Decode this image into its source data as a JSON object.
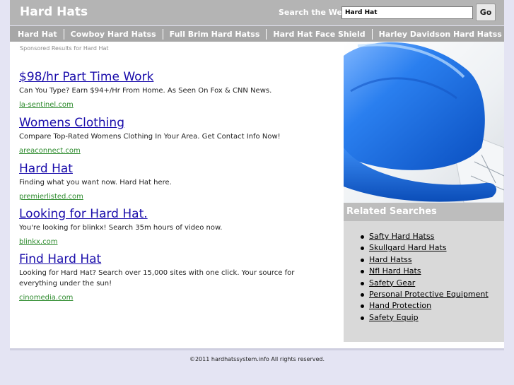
{
  "header": {
    "site_title": "Hard Hats",
    "search_label": "Search the Web:",
    "search_value": "Hard Hat",
    "search_button": "Go"
  },
  "nav": {
    "items": [
      {
        "label": "Hard Hat"
      },
      {
        "label": "Cowboy Hard Hatss"
      },
      {
        "label": "Full Brim Hard Hatss"
      },
      {
        "label": "Hard Hat Face Shield"
      },
      {
        "label": "Harley Davidson Hard Hatss"
      }
    ]
  },
  "main": {
    "sponsored_label": "Sponsored Results for Hard Hat",
    "ads": [
      {
        "title": "$98/hr Part Time Work",
        "description": "Can You Type? Earn $94+/Hr From Home. As Seen On Fox & CNN News.",
        "url": "la-sentinel.com"
      },
      {
        "title": "Womens Clothing",
        "description": "Compare Top-Rated Womens Clothing In Your Area. Get Contact Info Now!",
        "url": "areaconnect.com"
      },
      {
        "title": "Hard Hat",
        "description": "Finding what you want now. Hard Hat here.",
        "url": "premierlisted.com"
      },
      {
        "title": "Looking for Hard Hat.",
        "description": "You're looking for blinkx! Search 35m hours of video now.",
        "url": "blinkx.com"
      },
      {
        "title": "Find Hard Hat",
        "description": "Looking for Hard Hat? Search over 15,000 sites with one click. Your source for everything under the sun!",
        "url": "cinomedia.com"
      }
    ]
  },
  "sidebar": {
    "related_heading": "Related Searches",
    "related_items": [
      {
        "label": "Safty Hard Hatss"
      },
      {
        "label": "Skullgard Hard Hats"
      },
      {
        "label": "Hard Hatss"
      },
      {
        "label": "Nfl Hard Hats"
      },
      {
        "label": "Safety Gear"
      },
      {
        "label": "Personal Protective Equipment"
      },
      {
        "label": "Hand Protection"
      },
      {
        "label": "Safety Equip"
      }
    ]
  },
  "footer": {
    "copyright": "©2011 hardhatssystem.info All rights reserved."
  },
  "colors": {
    "page_bg": "#e4e4f3",
    "header_bg": "#b4b4b4",
    "nav_bg": "#a7a7a7",
    "ad_title_link": "#1a0dab",
    "ad_url": "#2e8b2e",
    "sidebar_bg": "#d9d9d9",
    "hardhat_blue": "#1f6fe0"
  },
  "icons": {
    "hero_image": "blue-hard-hat-on-blueprints"
  }
}
